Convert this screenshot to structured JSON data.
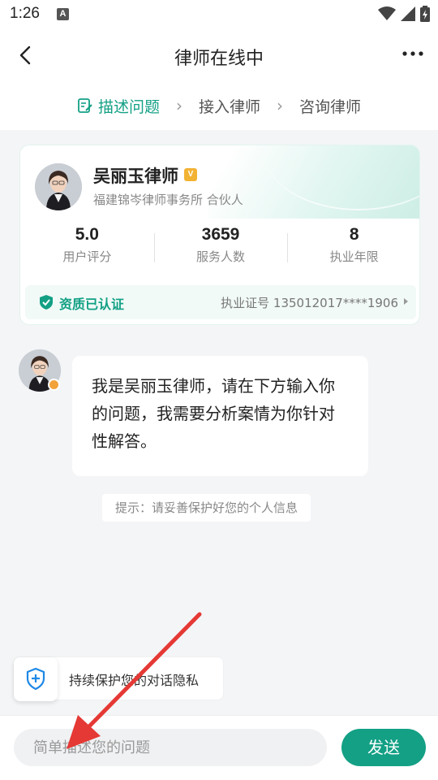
{
  "status_bar": {
    "time": "1:26",
    "app_icon_letter": "A",
    "icons": [
      "wifi-icon",
      "signal-icon",
      "battery-charging-icon"
    ]
  },
  "header": {
    "title": "律师在线中",
    "back_icon": "chevron-left-icon",
    "more_icon": "more-dots-icon"
  },
  "steps": [
    {
      "label": "描述问题",
      "active": true,
      "icon": "edit-doc-icon"
    },
    {
      "label": "接入律师",
      "active": false
    },
    {
      "label": "咨询律师",
      "active": false
    }
  ],
  "lawyer": {
    "name": "吴丽玉律师",
    "badge": "V",
    "firm": "福建锦岑律师事务所  合伙人",
    "stats": [
      {
        "value": "5.0",
        "label": "用户评分"
      },
      {
        "value": "3659",
        "label": "服务人数"
      },
      {
        "value": "8",
        "label": "执业年限"
      }
    ],
    "cert_label": "资质已认证",
    "license": "执业证号 135012017****1906"
  },
  "chat": {
    "message": "我是吴丽玉律师，请在下方输入你的问题，我需要分析案情为你针对性解答。",
    "tip": "提示：请妥善保护好您的个人信息"
  },
  "privacy": {
    "text": "持续保护您的对话隐私"
  },
  "input": {
    "placeholder": "简单描述您的问题",
    "send_label": "发送"
  },
  "colors": {
    "accent": "#13a085",
    "badge": "#f2b233",
    "annotation_arrow": "#e53935"
  }
}
